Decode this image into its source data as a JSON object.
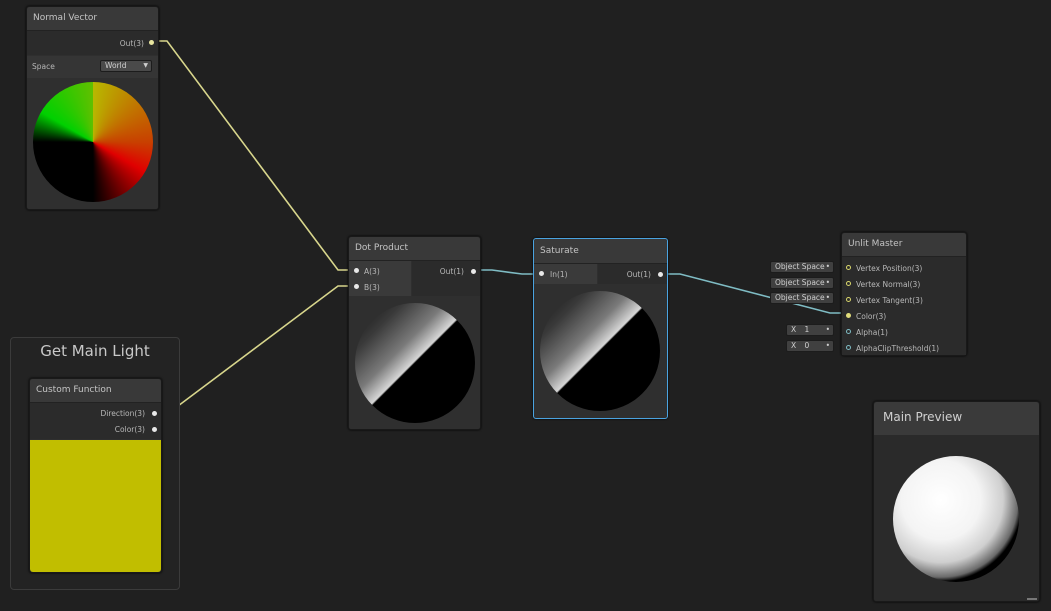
{
  "nodes": {
    "normal_vector": {
      "title": "Normal Vector",
      "out_label": "Out(3)",
      "space_label": "Space",
      "space_value": "World"
    },
    "group_get_main_light": {
      "title": "Get Main Light"
    },
    "custom_function": {
      "title": "Custom Function",
      "out_direction": "Direction(3)",
      "out_color": "Color(3)"
    },
    "dot_product": {
      "title": "Dot Product",
      "in_a": "A(3)",
      "in_b": "B(3)",
      "out_label": "Out(1)"
    },
    "saturate": {
      "title": "Saturate",
      "in_label": "In(1)",
      "out_label": "Out(1)"
    },
    "unlit_master": {
      "title": "Unlit Master",
      "inputs": [
        {
          "label": "Vertex Position(3)",
          "field": "Object Space"
        },
        {
          "label": "Vertex Normal(3)",
          "field": "Object Space"
        },
        {
          "label": "Vertex Tangent(3)",
          "field": "Object Space"
        },
        {
          "label": "Color(3)",
          "field": ""
        },
        {
          "label": "Alpha(1)",
          "field_x": "X",
          "field_value": "1"
        },
        {
          "label": "AlphaClipThreshold(1)",
          "field_x": "X",
          "field_value": "0"
        }
      ]
    },
    "main_preview": {
      "title": "Main Preview"
    }
  },
  "colors": {
    "background": "#202020",
    "wire_vector3": "#d8d68c",
    "wire_vector1": "#7fbcc4",
    "selection": "#4aa3e0",
    "custom_function_preview": "#c1be00"
  }
}
